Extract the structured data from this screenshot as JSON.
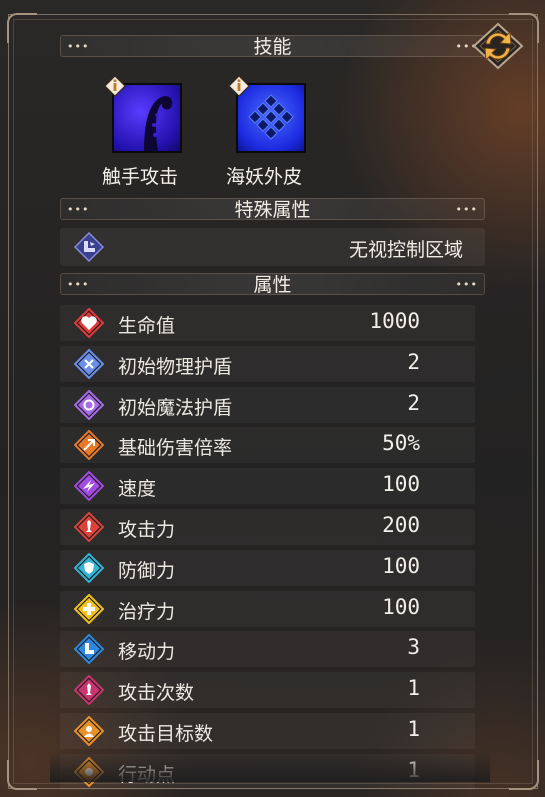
{
  "colors": {
    "accent_gold": "#e6a64a",
    "panel_border": "#7d6f60",
    "skill_purple": "#3b1fd0",
    "skill_blue": "#2a3bf0"
  },
  "sections": {
    "skills_title": "技能",
    "special_title": "特殊属性",
    "attributes_title": "属性"
  },
  "skills": [
    {
      "name": "触手攻击",
      "icon": "tentacle-icon"
    },
    {
      "name": "海妖外皮",
      "icon": "scales-icon"
    }
  ],
  "special": {
    "text": "无视控制区域",
    "icon": "boot-arrow-icon"
  },
  "attributes": [
    {
      "label": "生命值",
      "value": "1000",
      "icon": "heart-icon",
      "color": "#e23a3a"
    },
    {
      "label": "初始物理护盾",
      "value": "2",
      "icon": "physical-shield-icon",
      "color": "#6b8ee8"
    },
    {
      "label": "初始魔法护盾",
      "value": "2",
      "icon": "magic-shield-icon",
      "color": "#a86be8"
    },
    {
      "label": "基础伤害倍率",
      "value": "50%",
      "icon": "damage-rate-icon",
      "color": "#e8792a"
    },
    {
      "label": "速度",
      "value": "100",
      "icon": "speed-icon",
      "color": "#a24be0"
    },
    {
      "label": "攻击力",
      "value": "200",
      "icon": "attack-icon",
      "color": "#d9433a"
    },
    {
      "label": "防御力",
      "value": "100",
      "icon": "defense-icon",
      "color": "#33b4d4"
    },
    {
      "label": "治疗力",
      "value": "100",
      "icon": "heal-icon",
      "color": "#f1c21b"
    },
    {
      "label": "移动力",
      "value": "3",
      "icon": "move-icon",
      "color": "#2e88e0"
    },
    {
      "label": "攻击次数",
      "value": "1",
      "icon": "attack-count-icon",
      "color": "#c9356e"
    },
    {
      "label": "攻击目标数",
      "value": "1",
      "icon": "target-count-icon",
      "color": "#e8912a"
    },
    {
      "label": "行动点",
      "value": "1",
      "icon": "action-point-icon",
      "color": "#e8912a"
    }
  ]
}
